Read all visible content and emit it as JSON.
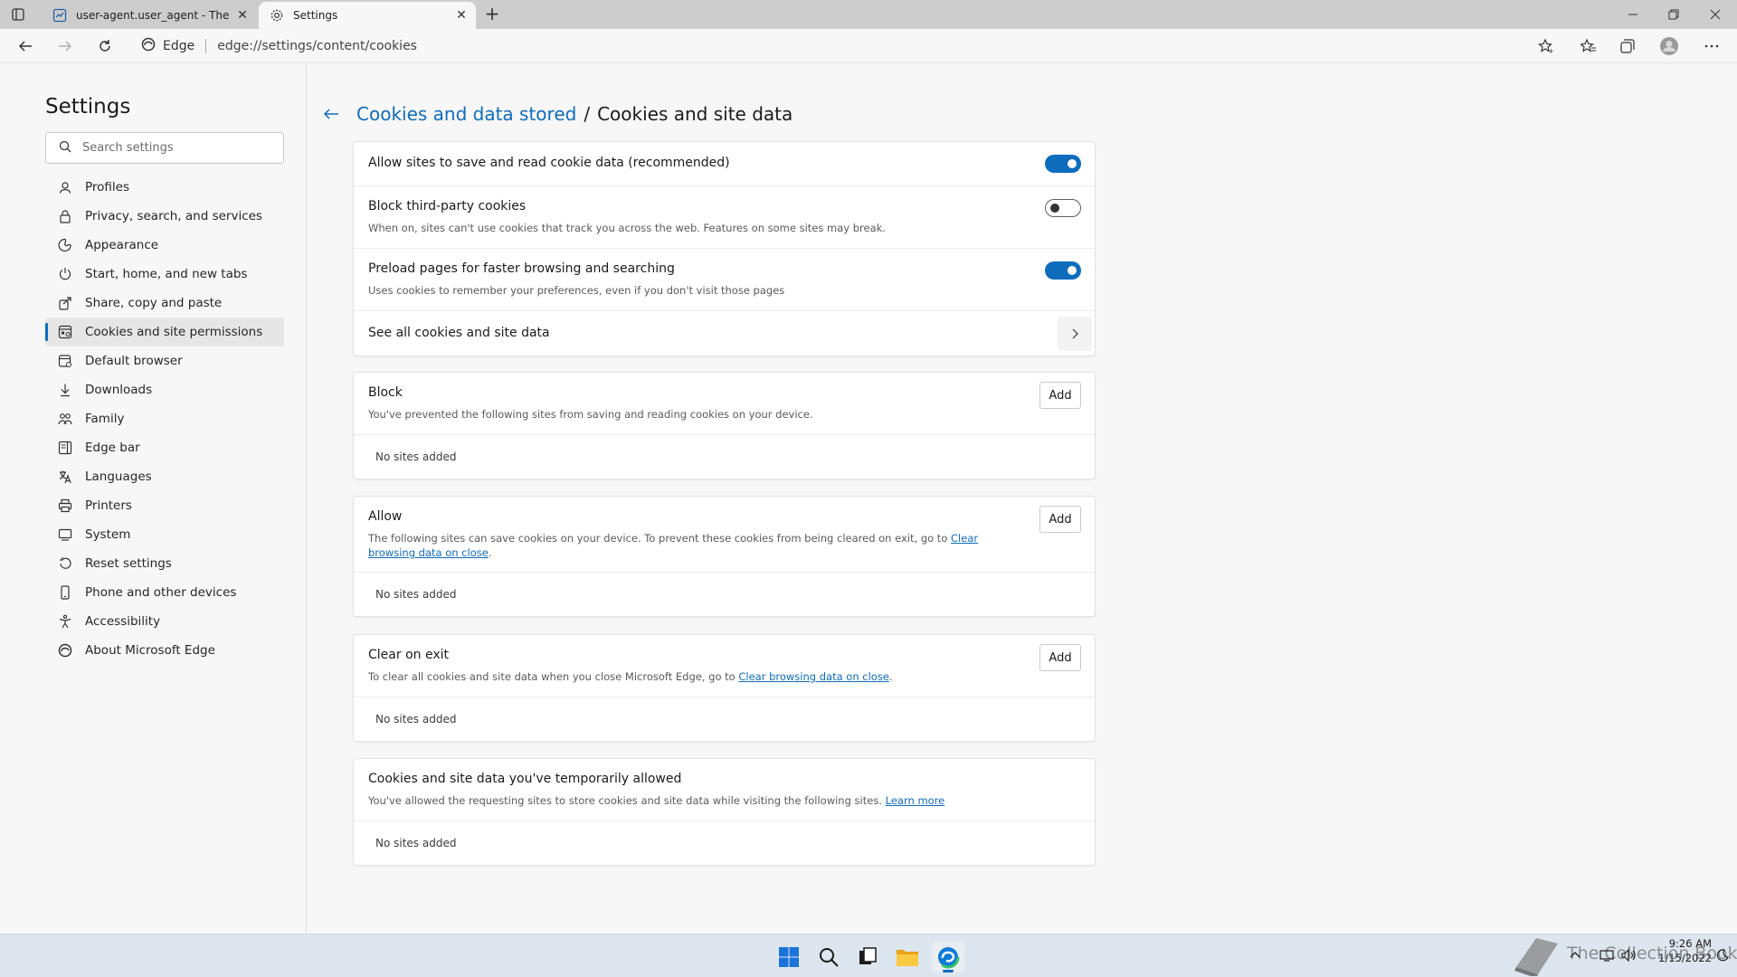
{
  "browser": {
    "tabs": [
      {
        "title": "user-agent.user_agent - The Coll",
        "favicon": "document-icon",
        "active": false
      },
      {
        "title": "Settings",
        "favicon": "gear-icon",
        "active": true
      }
    ],
    "address": {
      "site_label": "Edge",
      "url": "edge://settings/content/cookies"
    }
  },
  "sidebar": {
    "title": "Settings",
    "search_placeholder": "Search settings",
    "items": [
      {
        "label": "Profiles",
        "icon": "profile-icon"
      },
      {
        "label": "Privacy, search, and services",
        "icon": "lock-icon"
      },
      {
        "label": "Appearance",
        "icon": "appearance-icon"
      },
      {
        "label": "Start, home, and new tabs",
        "icon": "power-icon"
      },
      {
        "label": "Share, copy and paste",
        "icon": "share-icon"
      },
      {
        "label": "Cookies and site permissions",
        "icon": "cookies-icon",
        "selected": true
      },
      {
        "label": "Default browser",
        "icon": "browser-icon"
      },
      {
        "label": "Downloads",
        "icon": "download-icon"
      },
      {
        "label": "Family",
        "icon": "family-icon"
      },
      {
        "label": "Edge bar",
        "icon": "edge-bar-icon"
      },
      {
        "label": "Languages",
        "icon": "languages-icon"
      },
      {
        "label": "Printers",
        "icon": "printer-icon"
      },
      {
        "label": "System",
        "icon": "system-icon"
      },
      {
        "label": "Reset settings",
        "icon": "reset-icon"
      },
      {
        "label": "Phone and other devices",
        "icon": "phone-icon"
      },
      {
        "label": "Accessibility",
        "icon": "accessibility-icon"
      },
      {
        "label": "About Microsoft Edge",
        "icon": "edge-logo-icon"
      }
    ]
  },
  "main": {
    "breadcrumb": {
      "parent": "Cookies and data stored",
      "separator": "/",
      "current": "Cookies and site data"
    },
    "settings": {
      "allow_sites": {
        "title": "Allow sites to save and read cookie data (recommended)",
        "enabled": true
      },
      "block_third_party": {
        "title": "Block third-party cookies",
        "desc": "When on, sites can't use cookies that track you across the web. Features on some sites may break.",
        "enabled": false
      },
      "preload": {
        "title": "Preload pages for faster browsing and searching",
        "desc": "Uses cookies to remember your preferences, even if you don't visit those pages",
        "enabled": true
      },
      "see_all": {
        "title": "See all cookies and site data"
      }
    },
    "block": {
      "title": "Block",
      "desc": "You've prevented the following sites from saving and reading cookies on your device.",
      "add": "Add",
      "empty": "No sites added"
    },
    "allow": {
      "title": "Allow",
      "desc": "The following sites can save cookies on your device. To prevent these cookies from being cleared on exit, go to ",
      "link": "Clear browsing data on close",
      "after": ".",
      "add": "Add",
      "empty": "No sites added"
    },
    "clear_on_exit": {
      "title": "Clear on exit",
      "desc": "To clear all cookies and site data when you close Microsoft Edge, go to ",
      "link": "Clear browsing data on close",
      "after": ".",
      "add": "Add",
      "empty": "No sites added"
    },
    "temp_allowed": {
      "title": "Cookies and site data you've temporarily allowed",
      "desc": "You've allowed the requesting sites to store cookies and site data while visiting the following sites. ",
      "link": "Learn more",
      "empty": "No sites added"
    }
  },
  "taskbar": {
    "apps": [
      "windows-start-icon",
      "search-icon",
      "task-view-icon",
      "file-explorer-icon",
      "edge-icon"
    ],
    "watermark": "The Collection Book",
    "time": "9:26 AM",
    "date": "1/15/2022"
  },
  "colors": {
    "accent": "#0f6cbd",
    "taskbar": "#dde5ee"
  }
}
